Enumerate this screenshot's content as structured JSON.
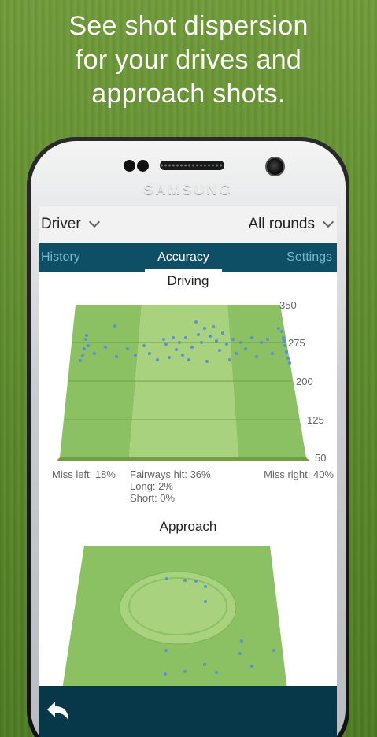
{
  "headline": "See shot dispersion\nfor your drives and\napproach shots.",
  "device": {
    "brand": "SAMSUNG"
  },
  "selectors": {
    "club": "Driver",
    "rounds": "All rounds"
  },
  "tabs": [
    {
      "label": "History",
      "active": false
    },
    {
      "label": "Accuracy",
      "active": true
    },
    {
      "label": "Settings",
      "active": false
    }
  ],
  "driving": {
    "title": "Driving",
    "y_ticks": [
      "350",
      "275",
      "200",
      "125",
      "50"
    ],
    "stats": {
      "miss_left": "Miss left: 18%",
      "fairways_hit": "Fairways hit: 36%",
      "long": "Long: 2%",
      "short": "Short: 0%",
      "miss_right": "Miss right: 40%"
    }
  },
  "approach": {
    "title": "Approach"
  },
  "colors": {
    "headline_text": "#ffffff",
    "tab_bar": "#0e4f66",
    "bottom_bar": "#07384a",
    "fairway": "#a9d27f",
    "rough": "#8cc163",
    "shot_dot": "#5b8fd6"
  },
  "icons": {
    "back": "back-arrow-icon",
    "dropdown": "chevron-down-icon"
  }
}
